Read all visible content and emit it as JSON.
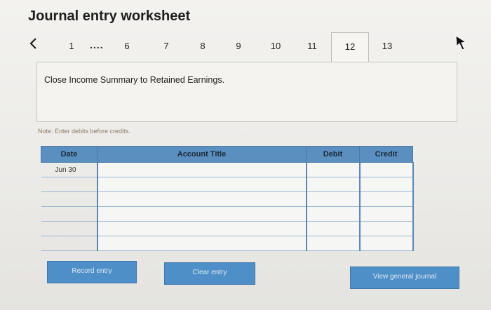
{
  "title": "Journal entry worksheet",
  "nav": {
    "prev_icon": "chevron-left-icon",
    "steps": [
      "1",
      "6",
      "7",
      "8",
      "9",
      "10",
      "11",
      "12",
      "13"
    ],
    "ellipsis": "....",
    "active_step": "12"
  },
  "instruction": "Close Income Summary to Retained Earnings.",
  "note": "Note: Enter debits before credits.",
  "table": {
    "headers": {
      "date": "Date",
      "account": "Account Title",
      "debit": "Debit",
      "credit": "Credit"
    },
    "rows": [
      {
        "date": "Jun 30",
        "account": "",
        "debit": "",
        "credit": ""
      },
      {
        "date": "",
        "account": "",
        "debit": "",
        "credit": ""
      },
      {
        "date": "",
        "account": "",
        "debit": "",
        "credit": ""
      },
      {
        "date": "",
        "account": "",
        "debit": "",
        "credit": ""
      },
      {
        "date": "",
        "account": "",
        "debit": "",
        "credit": ""
      },
      {
        "date": "",
        "account": "",
        "debit": "",
        "credit": ""
      }
    ]
  },
  "buttons": {
    "record": "Record entry",
    "clear": "Clear entry",
    "view": "View general journal"
  },
  "colors": {
    "accent": "#4f8fc7",
    "header": "#5b8fc0"
  }
}
